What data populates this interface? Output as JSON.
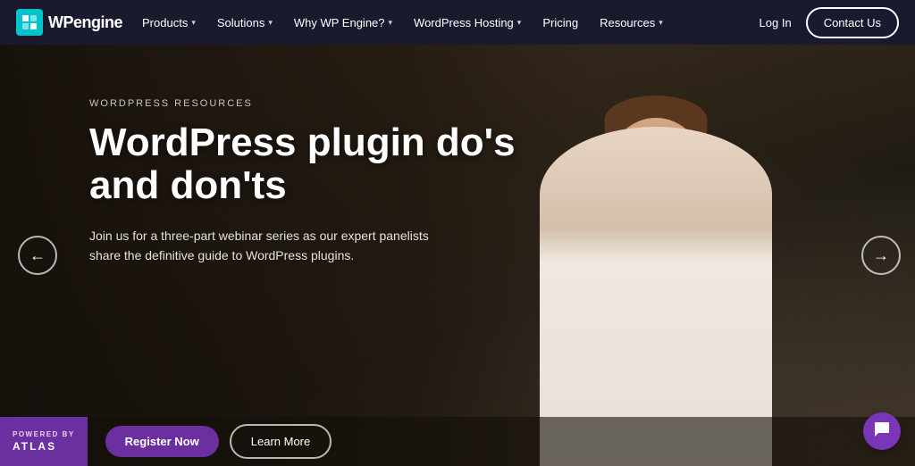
{
  "navbar": {
    "logo_wp": "WP",
    "logo_engine": "engine",
    "nav_items": [
      {
        "label": "Products",
        "has_chevron": true
      },
      {
        "label": "Solutions",
        "has_chevron": true
      },
      {
        "label": "Why WP Engine?",
        "has_chevron": true
      },
      {
        "label": "WordPress Hosting",
        "has_chevron": true
      },
      {
        "label": "Pricing",
        "has_chevron": false
      },
      {
        "label": "Resources",
        "has_chevron": true
      }
    ],
    "login_label": "Log In",
    "contact_label": "Contact Us"
  },
  "hero": {
    "eyebrow": "WORDPRESS RESOURCES",
    "title": "WordPress plugin do's and don'ts",
    "subtitle": "Join us for a three-part webinar series as our expert panelists share the definitive guide to WordPress plugins.",
    "prev_arrow": "←",
    "next_arrow": "→"
  },
  "bottom": {
    "powered_by": "POWERED BY",
    "powered_name": "ATLAS",
    "cta_primary": "Register Now",
    "cta_secondary": "Learn More"
  },
  "chat": {
    "icon": "💬"
  }
}
